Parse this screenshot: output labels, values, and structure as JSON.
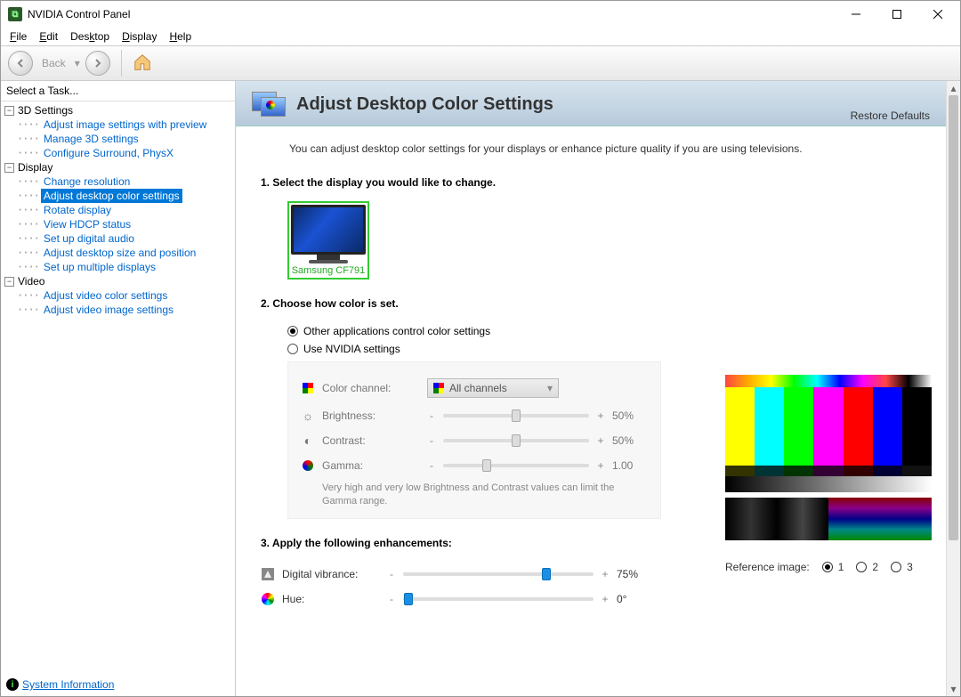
{
  "window": {
    "title": "NVIDIA Control Panel"
  },
  "menu": {
    "file": "File",
    "edit": "Edit",
    "desktop": "Desktop",
    "display": "Display",
    "help": "Help"
  },
  "toolbar": {
    "back": "Back"
  },
  "sidebar": {
    "header": "Select a Task...",
    "groups": [
      {
        "label": "3D Settings",
        "items": [
          "Adjust image settings with preview",
          "Manage 3D settings",
          "Configure Surround, PhysX"
        ]
      },
      {
        "label": "Display",
        "items": [
          "Change resolution",
          "Adjust desktop color settings",
          "Rotate display",
          "View HDCP status",
          "Set up digital audio",
          "Adjust desktop size and position",
          "Set up multiple displays"
        ]
      },
      {
        "label": "Video",
        "items": [
          "Adjust video color settings",
          "Adjust video image settings"
        ]
      }
    ],
    "selected": "Adjust desktop color settings",
    "sysinfo": "System Information"
  },
  "page": {
    "title": "Adjust Desktop Color Settings",
    "restore": "Restore Defaults",
    "subtitle": "You can adjust desktop color settings for your displays or enhance picture quality if you are using televisions."
  },
  "sections": {
    "s1_title": "1. Select the display you would like to change.",
    "display_name": "Samsung CF791",
    "s2_title": "2. Choose how color is set.",
    "radio1": "Other applications control color settings",
    "radio2": "Use NVIDIA settings",
    "color_channel_label": "Color channel:",
    "color_channel_value": "All channels",
    "brightness_label": "Brightness:",
    "brightness_value": "50%",
    "contrast_label": "Contrast:",
    "contrast_value": "50%",
    "gamma_label": "Gamma:",
    "gamma_value": "1.00",
    "note": "Very high and very low Brightness and Contrast values can limit the Gamma range.",
    "s3_title": "3. Apply the following enhancements:",
    "vibrance_label": "Digital vibrance:",
    "vibrance_value": "75%",
    "hue_label": "Hue:",
    "hue_value": "0°",
    "ref_label": "Reference image:",
    "ref_options": [
      "1",
      "2",
      "3"
    ]
  },
  "chart_data": {
    "type": "table",
    "title": "Display color sliders",
    "rows": [
      {
        "control": "Brightness",
        "value": 50,
        "unit": "%",
        "range": [
          0,
          100
        ]
      },
      {
        "control": "Contrast",
        "value": 50,
        "unit": "%",
        "range": [
          0,
          100
        ]
      },
      {
        "control": "Gamma",
        "value": 1.0,
        "unit": "",
        "range": [
          0.3,
          2.8
        ]
      },
      {
        "control": "Digital vibrance",
        "value": 75,
        "unit": "%",
        "range": [
          0,
          100
        ]
      },
      {
        "control": "Hue",
        "value": 0,
        "unit": "°",
        "range": [
          -180,
          180
        ]
      }
    ]
  }
}
